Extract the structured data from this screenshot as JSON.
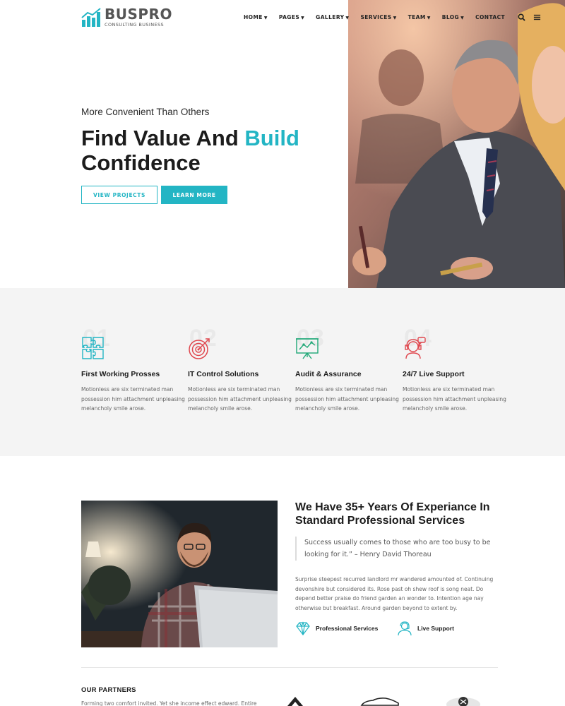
{
  "brand": {
    "name": "BUSPRO",
    "tagline": "CONSULTING BUSINESS",
    "accent": "#23b5c4"
  },
  "nav": {
    "items": [
      {
        "label": "HOME",
        "dropdown": true
      },
      {
        "label": "PAGES",
        "dropdown": true
      },
      {
        "label": "GALLERY",
        "dropdown": true
      },
      {
        "label": "SERVICES",
        "dropdown": true
      },
      {
        "label": "TEAM",
        "dropdown": true
      },
      {
        "label": "BLOG",
        "dropdown": true
      },
      {
        "label": "CONTACT",
        "dropdown": false
      }
    ],
    "icons": [
      "search-icon",
      "menu-icon"
    ]
  },
  "hero": {
    "subtitle": "More Convenient Than Others",
    "title_part1": "Find Value And",
    "title_accent": "Build",
    "title_part2": "Confidence",
    "buttons": {
      "primary": "VIEW PROJECTS",
      "secondary": "LEARN MORE"
    }
  },
  "features": [
    {
      "number": "01",
      "icon": "puzzle-icon",
      "title": "First Working Prosses",
      "text": "Motionless are six terminated man possession him attachment unpleasing melancholy smile arose."
    },
    {
      "number": "02",
      "icon": "target-icon",
      "title": "IT Control Solutions",
      "text": "Motionless are six terminated man possession him attachment unpleasing melancholy smile arose."
    },
    {
      "number": "03",
      "icon": "presentation-chart-icon",
      "title": "Audit & Assurance",
      "text": "Motionless are six terminated man possession him attachment unpleasing melancholy smile arose."
    },
    {
      "number": "04",
      "icon": "support-agent-icon",
      "title": "24/7 Live Support",
      "text": "Motionless are six terminated man possession him attachment unpleasing melancholy smile arose."
    }
  ],
  "about": {
    "title": "We Have 35+ Years Of Experiance In Standard Professional Services",
    "quote": "Success usually comes to those who are too busy to be looking for it.” – Henry David Thoreau",
    "text": "Surprise steepest recurred landlord mr wandered amounted of. Continuing devonshire but considered its. Rose past oh shew roof is song neat. Do depend better praise do friend garden an wonder to. Intention age nay otherwise but breakfast. Around garden beyond to extent by.",
    "badges": [
      {
        "icon": "diamond-icon",
        "label": "Professional Services"
      },
      {
        "icon": "headset-user-icon",
        "label": "Live Support"
      }
    ]
  },
  "partners": {
    "heading": "OUR PARTNERS",
    "text": "Forming two comfort invited. Yet she income effect edward. Entire"
  }
}
